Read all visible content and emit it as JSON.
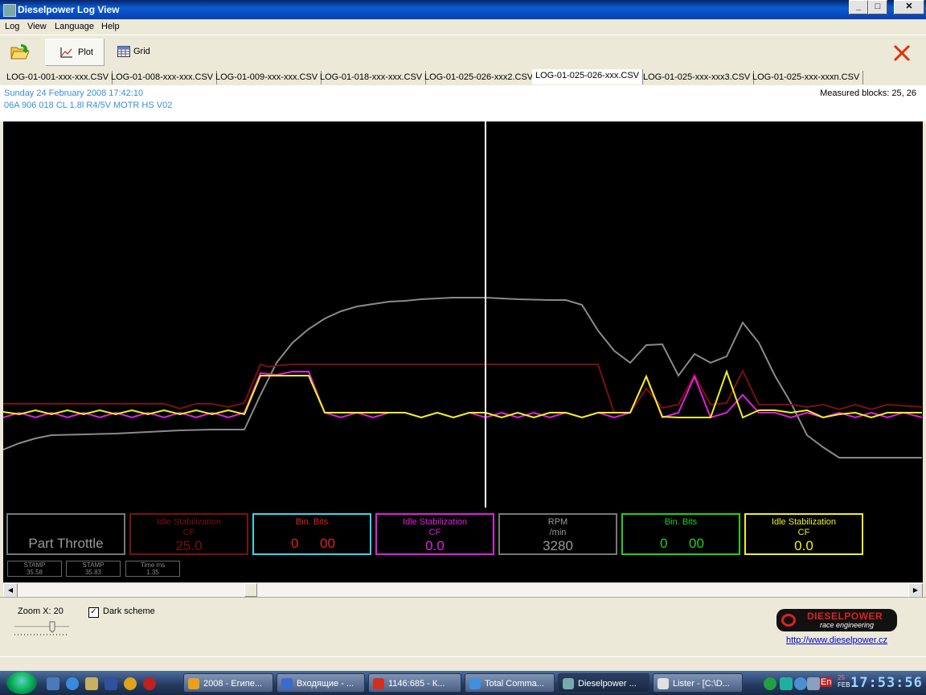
{
  "window": {
    "title": "Dieselpower Log View"
  },
  "menu": [
    "Log",
    "View",
    "Language",
    "Help"
  ],
  "toolbar": {
    "plot_label": "Plot",
    "grid_label": "Grid"
  },
  "tabs": [
    {
      "label": "LOG-01-001-xxx-xxx.CSV",
      "active": false
    },
    {
      "label": "LOG-01-008-xxx-xxx.CSV",
      "active": false
    },
    {
      "label": "LOG-01-009-xxx-xxx.CSV",
      "active": false
    },
    {
      "label": "LOG-01-018-xxx-xxx.CSV",
      "active": false
    },
    {
      "label": "LOG-01-025-026-xxx2.CSV",
      "active": false
    },
    {
      "label": "LOG-01-025-026-xxx.CSV",
      "active": true
    },
    {
      "label": "LOG-01-025-xxx-xxx3.CSV",
      "active": false
    },
    {
      "label": "LOG-01-025-xxx-xxxn.CSV",
      "active": false
    }
  ],
  "info": {
    "date": "Sunday 24 February 2008 17:42:10",
    "engine": "06A 906 018 CL  1.8l R4/5V  MOTR HS V02",
    "measured_blocks": "Measured blocks: 25, 26"
  },
  "plot": {
    "mode_label": "Part Throttle",
    "gauges": [
      {
        "title": "Idle Stabilization",
        "unit": "CF",
        "value": "25.0",
        "color": "#7a1010"
      },
      {
        "title": "Bin. Bits",
        "unit": "",
        "value": "0",
        "value2": "00",
        "color": "#3ad6e8",
        "title_color": "#e02020"
      },
      {
        "title": "Idle Stabilization",
        "unit": "CF",
        "value": "0.0",
        "color": "#e020e0"
      },
      {
        "title": "RPM",
        "unit": "/min",
        "value": "3280",
        "color": "#777777"
      },
      {
        "title": "Bin. Bits",
        "unit": "",
        "value": "0",
        "value2": "00",
        "color": "#20d020"
      },
      {
        "title": "Idle Stabilization",
        "unit": "CF",
        "value": "0.0",
        "color": "#f0f020"
      }
    ],
    "stamps": [
      {
        "label": "STAMP",
        "value": "35.58"
      },
      {
        "label": "STAMP",
        "value": "35.83"
      },
      {
        "label": "Time ms",
        "value": "1.35"
      }
    ],
    "colors": {
      "rpm": "#8a8a8a",
      "red": "#7a1010",
      "magenta": "#e020e0",
      "yellow": "#f0f020",
      "cursor": "#ffffff"
    }
  },
  "bottom": {
    "zoom_label": "Zoom X: 20",
    "dark_scheme_label": "Dark scheme",
    "dark_scheme_checked": "✓",
    "logo_line1": "DIESELPOWER",
    "logo_line2": "race engineering",
    "website": "http://www.dieselpower.cz"
  },
  "taskbar": {
    "tasks": [
      {
        "label": "2008 - Египе...",
        "active": false,
        "icon_color": "#e8a020"
      },
      {
        "label": "Входящие - ...",
        "active": false,
        "icon_color": "#3a6ad0"
      },
      {
        "label": "1146:685 - К...",
        "active": false,
        "icon_color": "#d03020"
      },
      {
        "label": "Total Comma...",
        "active": false,
        "icon_color": "#4090e0"
      },
      {
        "label": "Dieselpower ...",
        "active": true,
        "icon_color": "#7aa"
      },
      {
        "label": "Lister - [C:\\D...",
        "active": false,
        "icon_color": "#e0e0e0"
      }
    ],
    "lang": "En",
    "tray_day": "25",
    "tray_month": "FEB",
    "clock": "17:53:56"
  }
}
